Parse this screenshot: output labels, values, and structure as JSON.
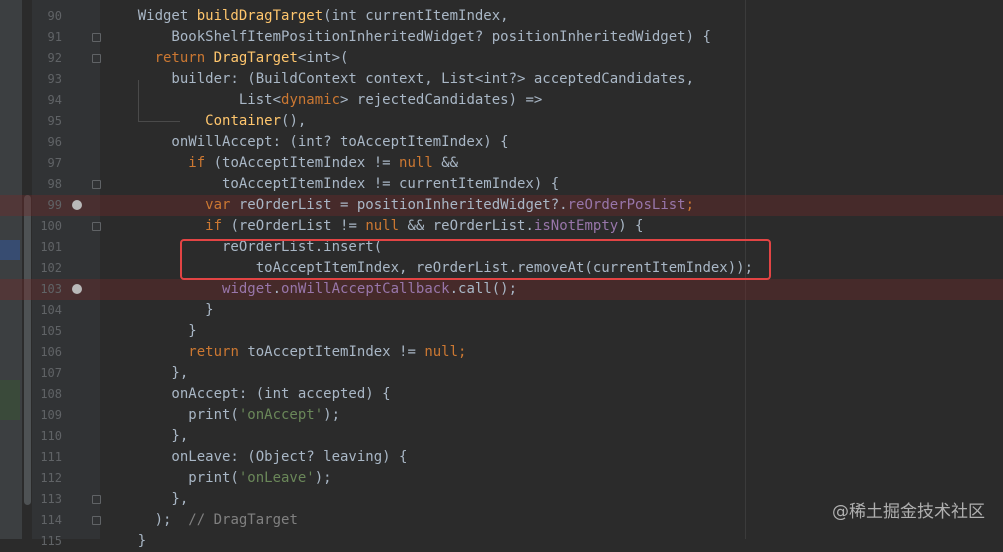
{
  "editor": {
    "lines": [
      {
        "no": "90",
        "tokens": [
          {
            "t": "    Widget ",
            "c": ""
          },
          {
            "t": "buildDragTarget",
            "c": "fn"
          },
          {
            "t": "(int currentItemIndex,",
            "c": ""
          }
        ]
      },
      {
        "no": "91",
        "tokens": [
          {
            "t": "        BookShelfItemPositionInheritedWidget? positionInheritedWidget) {",
            "c": ""
          }
        ]
      },
      {
        "no": "92",
        "tokens": [
          {
            "t": "      ",
            "c": ""
          },
          {
            "t": "return ",
            "c": "kw"
          },
          {
            "t": "DragTarget",
            "c": "fn"
          },
          {
            "t": "<int>(",
            "c": ""
          }
        ]
      },
      {
        "no": "93",
        "tokens": [
          {
            "t": "        builder: (BuildContext context, List<int?> acceptedCandidates,",
            "c": ""
          }
        ]
      },
      {
        "no": "94",
        "tokens": [
          {
            "t": "                List<",
            "c": ""
          },
          {
            "t": "dynamic",
            "c": "kw"
          },
          {
            "t": "> rejectedCandidates) =>",
            "c": ""
          }
        ]
      },
      {
        "no": "95",
        "tokens": [
          {
            "t": "            ",
            "c": ""
          },
          {
            "t": "Container",
            "c": "fn"
          },
          {
            "t": "(),",
            "c": ""
          }
        ]
      },
      {
        "no": "96",
        "tokens": [
          {
            "t": "        onWillAccept: (int? toAcceptItemIndex) {",
            "c": ""
          }
        ]
      },
      {
        "no": "97",
        "tokens": [
          {
            "t": "          ",
            "c": ""
          },
          {
            "t": "if ",
            "c": "kw"
          },
          {
            "t": "(toAcceptItemIndex != ",
            "c": ""
          },
          {
            "t": "null ",
            "c": "kw"
          },
          {
            "t": "&&",
            "c": ""
          }
        ]
      },
      {
        "no": "98",
        "tokens": [
          {
            "t": "              toAcceptItemIndex != currentItemIndex) {",
            "c": ""
          }
        ]
      },
      {
        "no": "99",
        "tokens": [
          {
            "t": "            ",
            "c": ""
          },
          {
            "t": "var ",
            "c": "kw"
          },
          {
            "t": "reOrderList = positionInheritedWidget?.",
            "c": ""
          },
          {
            "t": "reOrderPosList",
            "c": "prop"
          },
          {
            "t": ";",
            "c": "kw"
          }
        ]
      },
      {
        "no": "100",
        "tokens": [
          {
            "t": "            ",
            "c": ""
          },
          {
            "t": "if ",
            "c": "kw"
          },
          {
            "t": "(reOrderList != ",
            "c": ""
          },
          {
            "t": "null ",
            "c": "kw"
          },
          {
            "t": "&& reOrderList.",
            "c": ""
          },
          {
            "t": "isNotEmpty",
            "c": "prop"
          },
          {
            "t": ") {",
            "c": ""
          }
        ]
      },
      {
        "no": "101",
        "tokens": [
          {
            "t": "              reOrderList.insert(",
            "c": ""
          }
        ]
      },
      {
        "no": "102",
        "tokens": [
          {
            "t": "                  toAcceptItemIndex, reOrderList.removeAt(currentItemIndex));",
            "c": ""
          }
        ]
      },
      {
        "no": "103",
        "tokens": [
          {
            "t": "              ",
            "c": ""
          },
          {
            "t": "widget",
            "c": "prop"
          },
          {
            "t": ".",
            "c": ""
          },
          {
            "t": "onWillAcceptCallback",
            "c": "prop"
          },
          {
            "t": ".call();",
            "c": ""
          }
        ]
      },
      {
        "no": "104",
        "tokens": [
          {
            "t": "            }",
            "c": ""
          }
        ]
      },
      {
        "no": "105",
        "tokens": [
          {
            "t": "          }",
            "c": ""
          }
        ]
      },
      {
        "no": "106",
        "tokens": [
          {
            "t": "          ",
            "c": ""
          },
          {
            "t": "return ",
            "c": "kw"
          },
          {
            "t": "toAcceptItemIndex != ",
            "c": ""
          },
          {
            "t": "null",
            "c": "kw"
          },
          {
            "t": ";",
            "c": "kw"
          }
        ]
      },
      {
        "no": "107",
        "tokens": [
          {
            "t": "        },",
            "c": ""
          }
        ]
      },
      {
        "no": "108",
        "tokens": [
          {
            "t": "        onAccept: (int accepted) {",
            "c": ""
          }
        ]
      },
      {
        "no": "109",
        "tokens": [
          {
            "t": "          print(",
            "c": ""
          },
          {
            "t": "'onAccept'",
            "c": "str"
          },
          {
            "t": ");",
            "c": ""
          }
        ]
      },
      {
        "no": "110",
        "tokens": [
          {
            "t": "        },",
            "c": ""
          }
        ]
      },
      {
        "no": "111",
        "tokens": [
          {
            "t": "        onLeave: (Object? leaving) {",
            "c": ""
          }
        ]
      },
      {
        "no": "112",
        "tokens": [
          {
            "t": "          print(",
            "c": ""
          },
          {
            "t": "'onLeave'",
            "c": "str"
          },
          {
            "t": ");",
            "c": ""
          }
        ]
      },
      {
        "no": "113",
        "tokens": [
          {
            "t": "        },",
            "c": ""
          }
        ]
      },
      {
        "no": "114",
        "tokens": [
          {
            "t": "      );  ",
            "c": ""
          },
          {
            "t": "// DragTarget",
            "c": "cmt"
          }
        ]
      },
      {
        "no": "115",
        "tokens": [
          {
            "t": "    }",
            "c": ""
          }
        ]
      }
    ],
    "error_lines": [
      "99",
      "103"
    ],
    "breakpoint_lines": [
      "99",
      "103"
    ],
    "fold_lines": [
      "91",
      "92",
      "98",
      "100",
      "113",
      "114"
    ],
    "colors": {
      "background": "#2b2b2b",
      "keyword": "#cc7832",
      "function": "#ffc66d",
      "string": "#6a8759",
      "property": "#9876aa",
      "comment": "#808080",
      "highlight_box": "#e24444"
    }
  },
  "watermark": "@稀土掘金技术社区"
}
